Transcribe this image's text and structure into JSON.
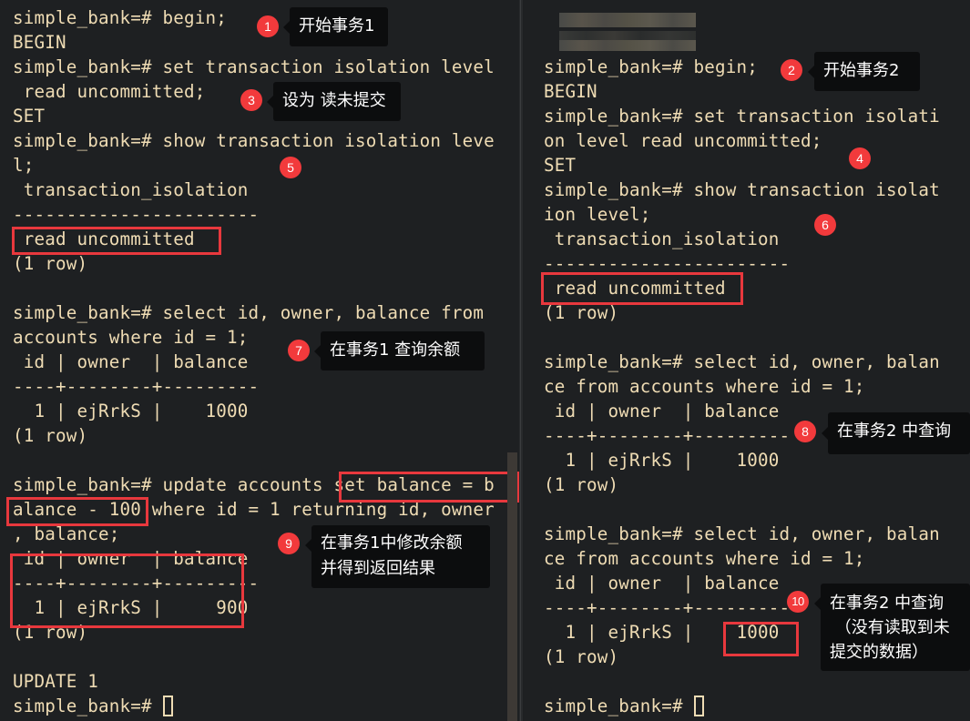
{
  "left_terminal": {
    "lines": [
      "simple_bank=# begin;",
      "BEGIN",
      "simple_bank=# set transaction isolation level",
      " read uncommitted;",
      "SET",
      "simple_bank=# show transaction isolation leve",
      "l;",
      " transaction_isolation",
      "-----------------------",
      " read uncommitted",
      "(1 row)",
      "",
      "simple_bank=# select id, owner, balance from",
      "accounts where id = 1;",
      " id | owner  | balance",
      "----+--------+---------",
      "  1 | ejRrkS |    1000",
      "(1 row)",
      "",
      "simple_bank=# update accounts set balance = b",
      "alance - 100 where id = 1 returning id, owner",
      ", balance;",
      " id | owner  | balance",
      "----+--------+---------",
      "  1 | ejRrkS |     900",
      "(1 row)",
      "",
      "UPDATE 1",
      "simple_bank=# "
    ]
  },
  "right_terminal": {
    "lines": [
      "simple_bank=# begin;",
      "BEGIN",
      "simple_bank=# set transaction isolati",
      "on level read uncommitted;",
      "SET",
      "simple_bank=# show transaction isolat",
      "ion level;",
      " transaction_isolation",
      "-----------------------",
      " read uncommitted",
      "(1 row)",
      "",
      "simple_bank=# select id, owner, balan",
      "ce from accounts where id = 1;",
      " id | owner  | balance",
      "----+--------+---------",
      "  1 | ejRrkS |    1000",
      "(1 row)",
      "",
      "simple_bank=# select id, owner, balan",
      "ce from accounts where id = 1;",
      " id | owner  | balance",
      "----+--------+---------",
      "  1 | ejRrkS |    1000",
      "(1 row)",
      "",
      "simple_bank=# "
    ]
  },
  "annotations": [
    {
      "number": "1",
      "text": "开始事务1"
    },
    {
      "number": "2",
      "text": "开始事务2"
    },
    {
      "number": "3",
      "text": "设为 读未提交"
    },
    {
      "number": "4",
      "text": ""
    },
    {
      "number": "5",
      "text": ""
    },
    {
      "number": "6",
      "text": ""
    },
    {
      "number": "7",
      "text": "在事务1 查询余额"
    },
    {
      "number": "8",
      "text": "在事务2 中查询"
    },
    {
      "number": "9",
      "text": "在事务1中修改余额\n并得到返回结果"
    },
    {
      "number": "10",
      "text": "在事务2 中查询\n （没有读取到未\n提交的数据）"
    }
  ],
  "colors": {
    "background": "#1e2022",
    "terminal_text": "#efdcb4",
    "highlight_box": "#e8383d",
    "badge": "#f23a3c",
    "tooltip_bg": "#0c0d0e"
  }
}
